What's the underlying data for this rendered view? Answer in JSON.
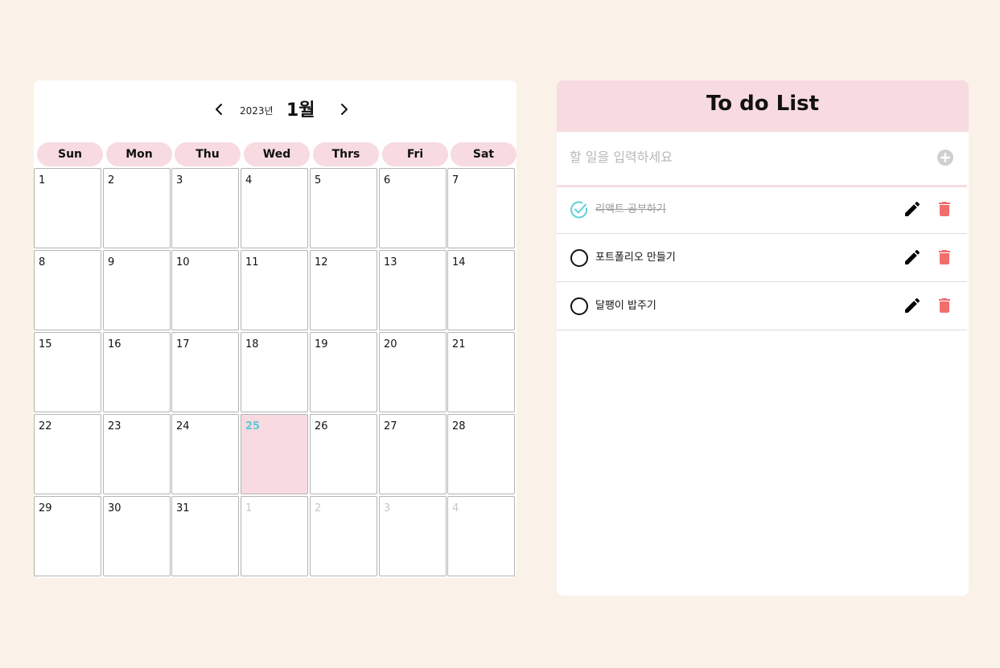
{
  "calendar": {
    "year": "2023년",
    "month": "1월",
    "prev_icon": "chevron-left-icon",
    "next_icon": "chevron-right-icon",
    "weekdays": [
      "Sun",
      "Mon",
      "Thu",
      "Wed",
      "Thrs",
      "Fri",
      "Sat"
    ],
    "weeks": [
      [
        "1",
        "2",
        "3",
        "4",
        "5",
        "6",
        "7"
      ],
      [
        "8",
        "9",
        "10",
        "11",
        "12",
        "13",
        "14"
      ],
      [
        "15",
        "16",
        "17",
        "18",
        "19",
        "20",
        "21"
      ],
      [
        "22",
        "23",
        "24",
        "25",
        "26",
        "27",
        "28"
      ],
      [
        "29",
        "30",
        "31",
        "1",
        "2",
        "3",
        "4"
      ]
    ],
    "today": "25",
    "next_month_days": [
      "1",
      "2",
      "3",
      "4"
    ],
    "colors": {
      "weekday_pill": "#f7dbe1",
      "today_bg": "#f7dbe1",
      "today_text": "#5fc8d8",
      "other_month_text": "#c8c8c8"
    }
  },
  "todo": {
    "title": "To do List",
    "input": {
      "placeholder": "할 일을 입력하세요",
      "value": ""
    },
    "add_icon": "plus-circle-icon",
    "items": [
      {
        "text": "리액트 공부하기",
        "done": true
      },
      {
        "text": "포트폴리오 만들기",
        "done": false
      },
      {
        "text": "달팽이 밥주기",
        "done": false
      }
    ],
    "colors": {
      "header": "#f7dbe1",
      "check_done": "#5fd0d8",
      "delete": "#f26d6d",
      "edit": "#000000"
    }
  }
}
